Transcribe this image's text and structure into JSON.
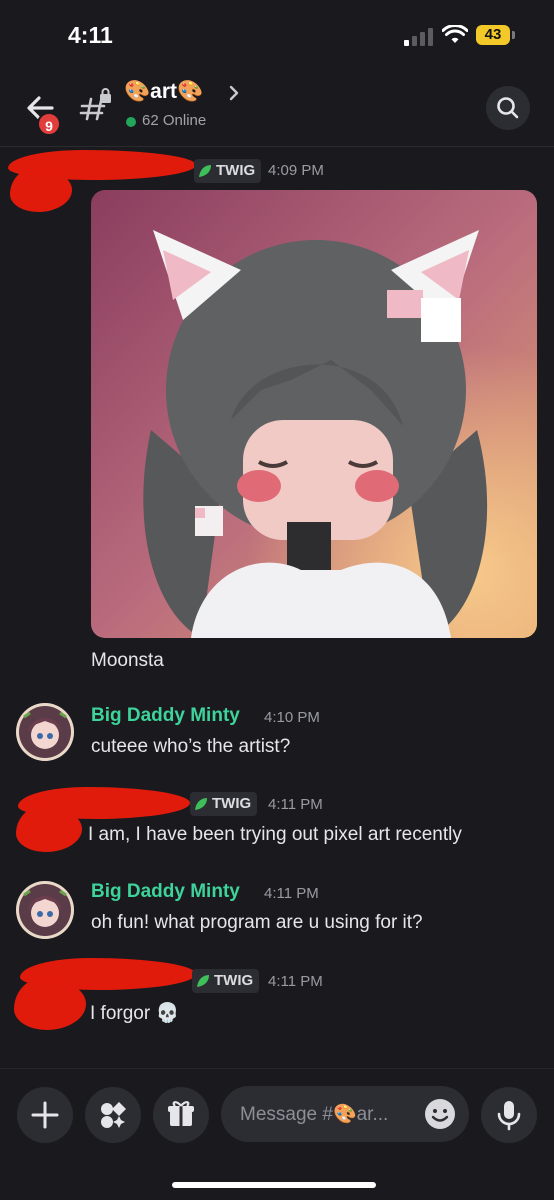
{
  "status_bar": {
    "time": "4:11",
    "battery": "43"
  },
  "header": {
    "back_badge": "9",
    "channel_name": "🎨art🎨",
    "online": "62 Online"
  },
  "messages": [
    {
      "author_redacted": true,
      "tag": "TWIG",
      "timestamp": "4:09 PM",
      "attachment": "pixel-art image",
      "text": "Moonsta"
    },
    {
      "author": "Big Daddy Minty",
      "timestamp": "4:10 PM",
      "text": "cuteee who’s the artist?"
    },
    {
      "author_redacted": true,
      "tag": "TWIG",
      "timestamp": "4:11 PM",
      "text": "I am, I have been trying out pixel art recently"
    },
    {
      "author": "Big Daddy Minty",
      "timestamp": "4:11 PM",
      "text": "oh fun! what program are u using for it?"
    },
    {
      "author_redacted": true,
      "tag": "TWIG",
      "timestamp": "4:11 PM",
      "text": "I forgor 💀"
    }
  ],
  "composer": {
    "placeholder": "Message #🎨ar..."
  },
  "colors": {
    "background": "#1a1a1e",
    "username": "#3dd39a",
    "redaction": "#e11b0c",
    "online": "#23a55a",
    "badge": "#e23d3d",
    "battery": "#f3c92a"
  },
  "icons": [
    "back-arrow-icon",
    "channel-hash-lock-icon",
    "chevron-right-icon",
    "search-icon",
    "leaf-icon",
    "plus-icon",
    "apps-icon",
    "gift-icon",
    "emoji-icon",
    "microphone-icon"
  ]
}
